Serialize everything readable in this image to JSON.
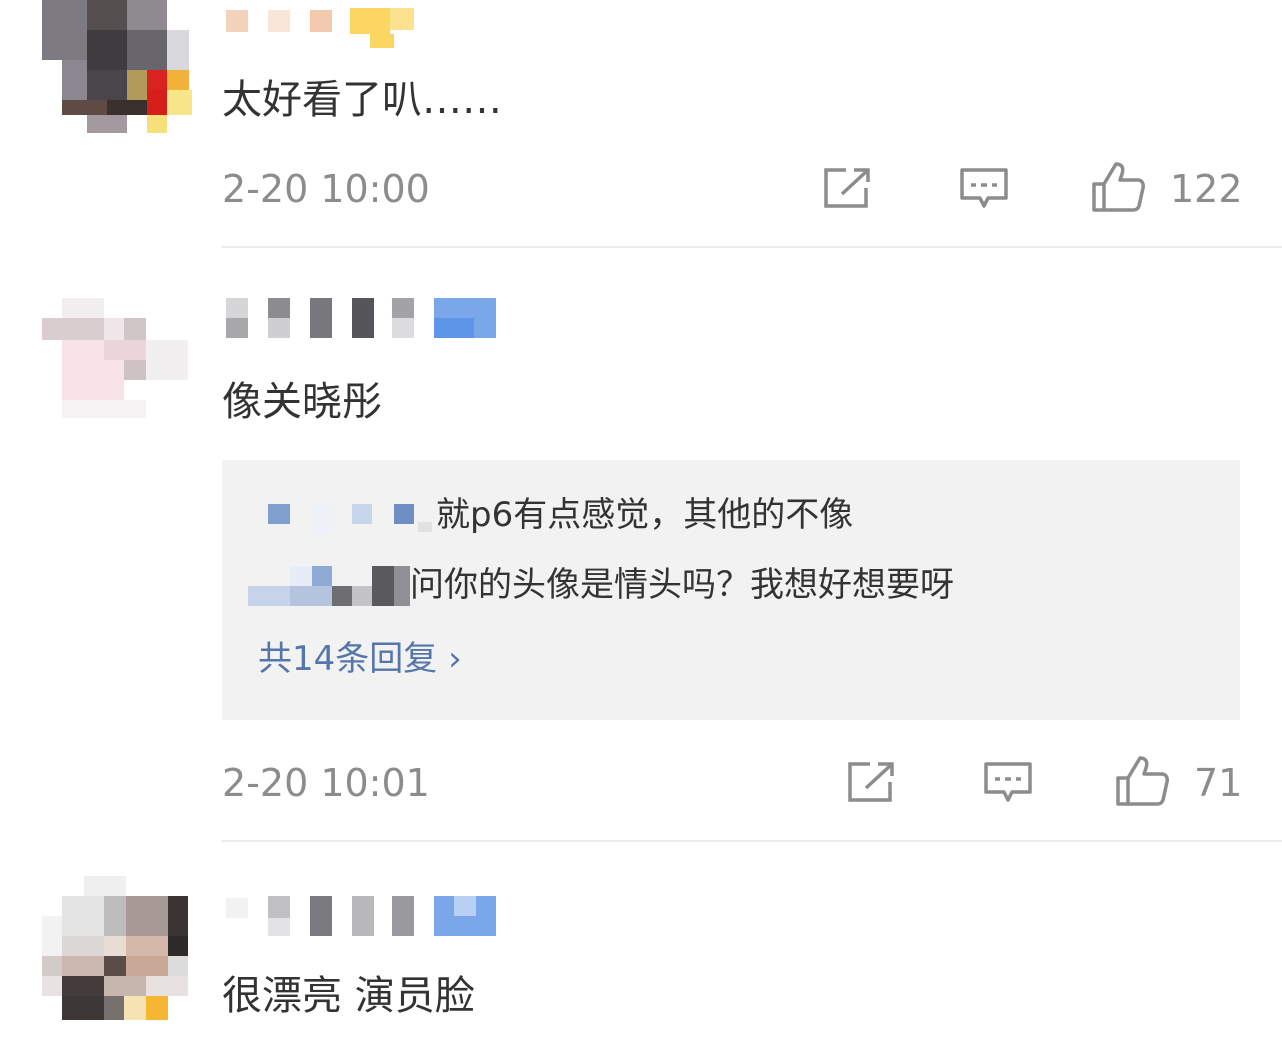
{
  "comments": [
    {
      "text": "太好看了叭……",
      "timestamp": "2-20 10:00",
      "like_count": "122",
      "icons": [
        "share-icon",
        "comment-icon",
        "like-icon"
      ]
    },
    {
      "text": "像关晓彤",
      "timestamp": "2-20 10:01",
      "like_count": "71",
      "icons": [
        "share-icon",
        "comment-icon",
        "like-icon"
      ],
      "replies": [
        "就p6有点感觉，其他的不像",
        "问你的头像是情头吗？我想好想要呀"
      ],
      "more_replies": "共14条回复 ›"
    },
    {
      "text": "很漂亮 演员脸"
    }
  ],
  "colors": {
    "text": "#333333",
    "meta": "#8c8c8c",
    "link": "#5576ab",
    "reply_bg": "#f2f2f2",
    "divider": "#ececec"
  }
}
